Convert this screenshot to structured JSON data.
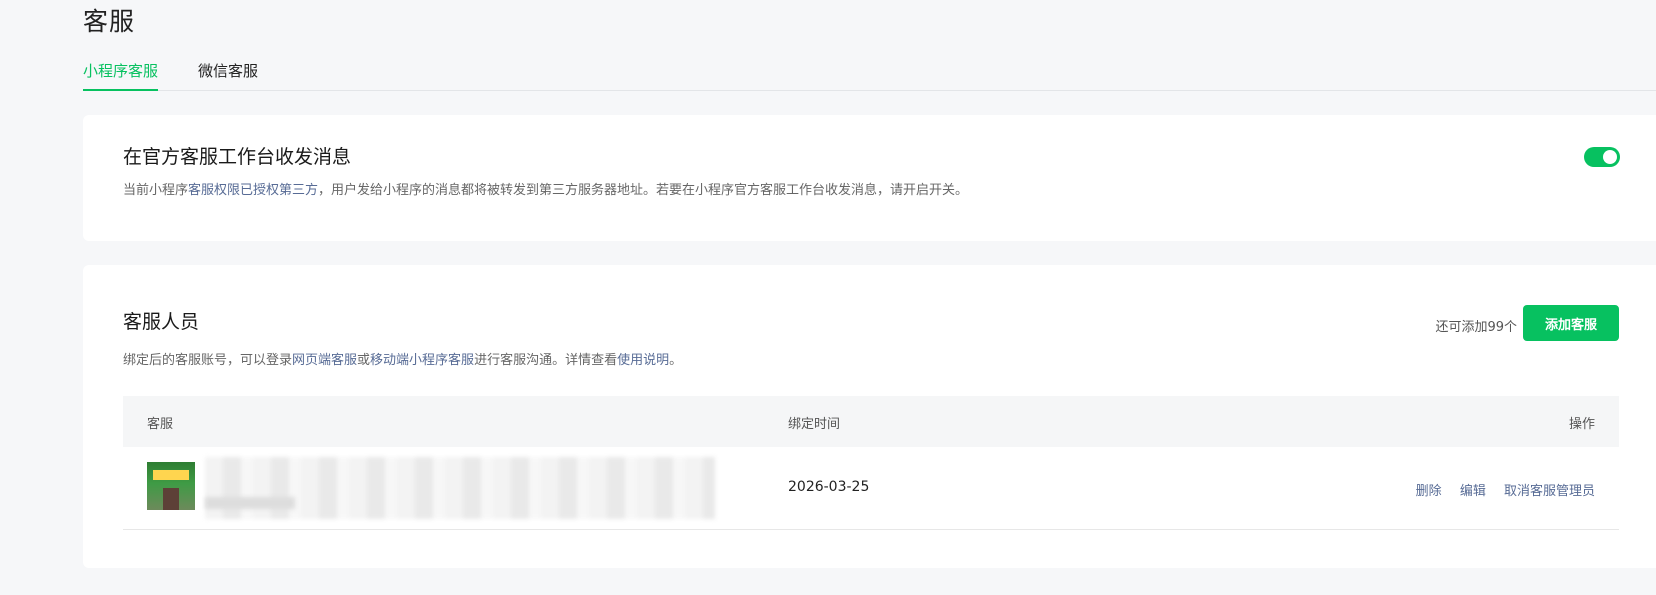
{
  "page": {
    "title": "客服"
  },
  "tabs": [
    {
      "label": "小程序客服",
      "active": true
    },
    {
      "label": "微信客服",
      "active": false
    }
  ],
  "official_card": {
    "title": "在官方客服工作台收发消息",
    "desc_prefix": "当前小程序",
    "desc_link": "客服权限已授权第三方",
    "desc_suffix": "，用户发给小程序的消息都将被转发到第三方服务器地址。若要在小程序官方客服工作台收发消息，请开启开关。",
    "toggle_on": true
  },
  "staff_card": {
    "title": "客服人员",
    "desc_part1": "绑定后的客服账号，可以登录",
    "desc_link1": "网页端客服",
    "desc_part2": "或",
    "desc_link2": "移动端小程序客服",
    "desc_part3": "进行客服沟通。详情查看",
    "desc_link3": "使用说明",
    "desc_part4": "。",
    "remaining": "还可添加99个",
    "add_button": "添加客服"
  },
  "table": {
    "headers": {
      "agent": "客服",
      "bind_time": "绑定时间",
      "actions": "操作"
    },
    "rows": [
      {
        "bind_time": "2026-03-25",
        "actions": {
          "delete": "删除",
          "edit": "编辑",
          "revoke": "取消客服管理员"
        }
      }
    ]
  },
  "colors": {
    "accent": "#07c160",
    "link": "#576b95"
  }
}
